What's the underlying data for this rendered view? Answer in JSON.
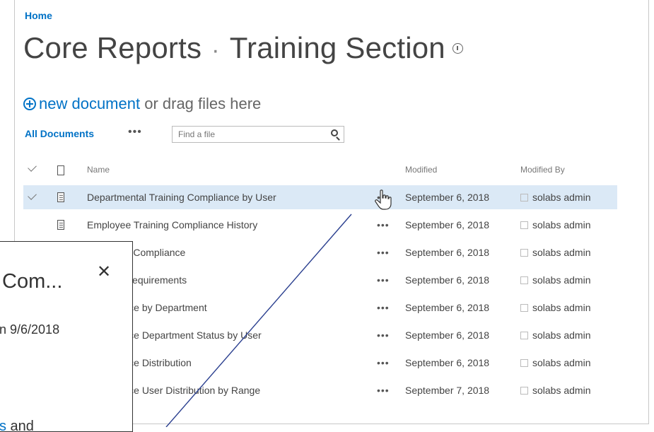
{
  "breadcrumb": {
    "home": "Home"
  },
  "title": {
    "site": "Core Reports",
    "separator": "·",
    "library": "Training Section"
  },
  "actions": {
    "new_document": "new document",
    "drag_text": " or drag files here"
  },
  "view": {
    "current": "All Documents",
    "more": "•••",
    "search_placeholder": "Find a file"
  },
  "table": {
    "headers": {
      "name": "Name",
      "modified": "Modified",
      "modified_by": "Modified By"
    },
    "ellipsis": "•••",
    "rows": [
      {
        "name": "Departmental Training Compliance by User",
        "modified": "September 6, 2018",
        "modified_by": "solabs admin"
      },
      {
        "name": "Employee Training Compliance History",
        "modified": "September 6, 2018",
        "modified_by": "solabs admin"
      },
      {
        "name": "e Training Compliance",
        "modified": "September 6, 2018",
        "modified_by": "solabs admin"
      },
      {
        "name": "Training Requirements",
        "modified": "September 6, 2018",
        "modified_by": "solabs admin"
      },
      {
        "name": "Compliance by Department",
        "modified": "September 6, 2018",
        "modified_by": "solabs admin"
      },
      {
        "name": "Compliance Department Status by User",
        "modified": "September 6, 2018",
        "modified_by": "solabs admin"
      },
      {
        "name": "Compliance Distribution",
        "modified": "September 6, 2018",
        "modified_by": "solabs admin"
      },
      {
        "name": "Compliance User Distribution by Range",
        "modified": "September 7, 2018",
        "modified_by": "solabs admin"
      }
    ]
  },
  "callout": {
    "title": "Com...",
    "close": "✕",
    "date": "n 9/6/2018",
    "link_tail": "s and",
    "link_text": "s"
  },
  "colors": {
    "accent": "#0072c6",
    "selected_row": "#dbe9f6",
    "annotation_line": "#2a3f8f"
  }
}
